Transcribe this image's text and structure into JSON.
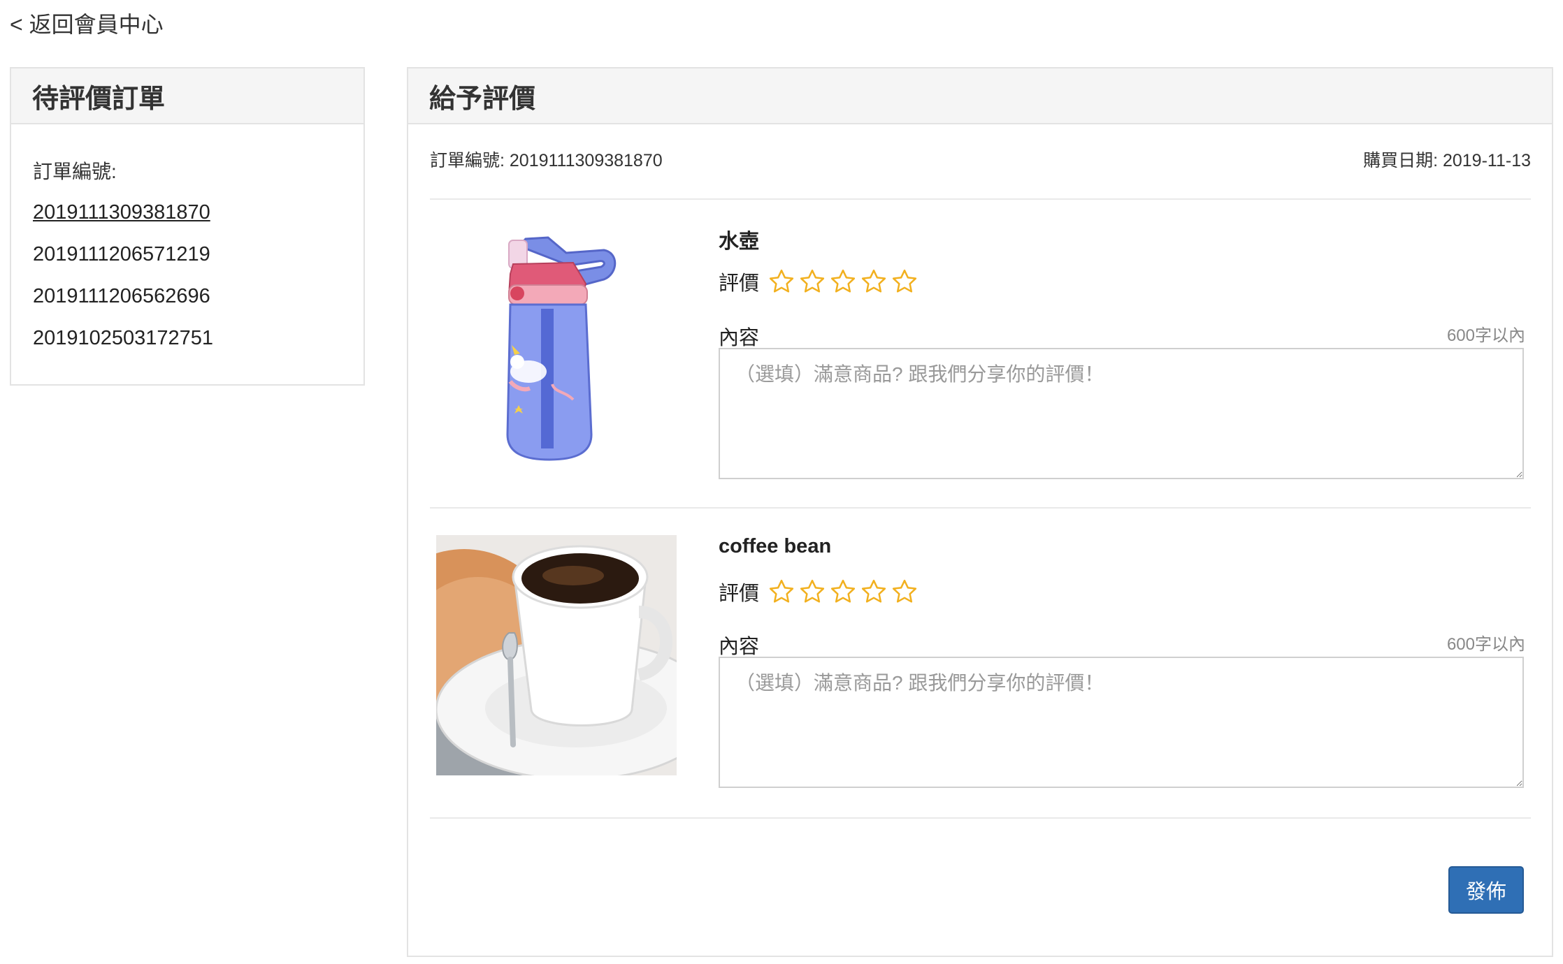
{
  "nav": {
    "back_label": "< 返回會員中心"
  },
  "left_panel": {
    "title": "待評價訂單",
    "order_label": "訂單編號:",
    "orders": [
      "2019111309381870",
      "2019111206571219",
      "2019111206562696",
      "2019102503172751"
    ],
    "active_index": 0
  },
  "right_panel": {
    "title": "給予評價",
    "order_number_text": "訂單編號: 2019111309381870",
    "purchase_date_text": "購買日期: 2019-11-13",
    "products": [
      {
        "name": "水壺",
        "image_icon": "water-bottle-image",
        "rating_label": "評價",
        "rating": 0,
        "rating_max": 5,
        "content_label": "內容",
        "limit_text": "600字以內",
        "placeholder": "（選填）滿意商品? 跟我們分享你的評價！"
      },
      {
        "name": "coffee bean",
        "image_icon": "coffee-cup-image",
        "rating_label": "評價",
        "rating": 0,
        "rating_max": 5,
        "content_label": "內容",
        "limit_text": "600字以內",
        "placeholder": "（選填）滿意商品? 跟我們分享你的評價！"
      }
    ],
    "publish_label": "發佈"
  },
  "colors": {
    "star": "#f2b01e",
    "button": "#2f6fb5",
    "panel_header": "#f5f5f5"
  }
}
